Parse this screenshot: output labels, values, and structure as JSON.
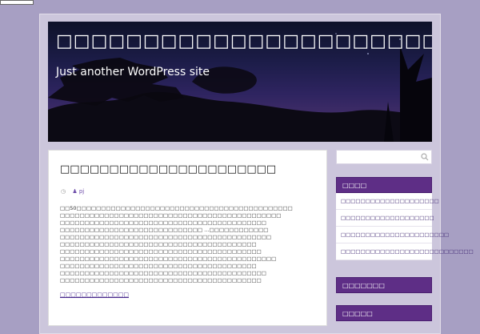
{
  "site": {
    "title": "□□□□□□□□□□□□□□□□□□□□□□□□□□□□□",
    "description": "Just another WordPress site"
  },
  "post": {
    "title": "□□□□□□□□□□□□□□□□□□□□□□",
    "author": "pj",
    "excerpt": [
      "□□50□□□□□□□□□□□□□□□□□□□□□□□□□□□□□□□□□□□□□□□□□□□□",
      "□□□□□□□□□□□□□□□□□□□□□□□□□□□□□□□□□□□□□□□□□□□□□",
      "□□□□□□□□□□□□□□□□□□□□□□□□□□□□□□□□□□□□□□□□□□",
      "□□□□□□□□□□□□□□□□□□□□□□□□□□□□□ …□□□□□□□□□□□□",
      "□□□□□□□□□□□□□□□□□□□□□□□□□□□□□□□□□□□□□□□□□□□",
      "□□□□□□□□□□□□□□□□□□□□□□□□□□□□□□□□□□□□□□□□",
      "□□□□□□□□□□□□□□□□□□□□□□□□□□□□□□□□□□□□□□□□□",
      "□□□□□□□□□□□□□□□□□□□□□□□□□□□□□□□□□□□□□□□□□□□□",
      "□□□□□□□□□□□□□□□□□□□□□□□□□□□□□□□□□□□□□□□□",
      "□□□□□□□□□□□□□□□□□□□□□□□□□□□□□□□□□□□□□□□□□□",
      "□□□□□□□□□□□□□□□□□□□□□□□□□□□□□□□□□□□□□□□□□"
    ],
    "more_link": "□□□□□□□□□□□□□"
  },
  "sidebar": {
    "search_placeholder": "",
    "widgets": [
      {
        "title": "□□□□",
        "items": [
          "□□□□□□□□□□□□□□□□□□□□",
          "□□□□□□□□□□□□□□□□□□□",
          "□□□□□□□□□□□□□□□□□□□□□□",
          "□□□□□□□□□□□□□□□□□□□□□□□□□□□"
        ]
      },
      {
        "title": "□□□□□□□",
        "items": []
      },
      {
        "title": "□□□□□",
        "items": []
      }
    ]
  },
  "colors": {
    "page_bg": "#a79fc3",
    "accent": "#5e2e86",
    "link": "#4a2a8e"
  }
}
